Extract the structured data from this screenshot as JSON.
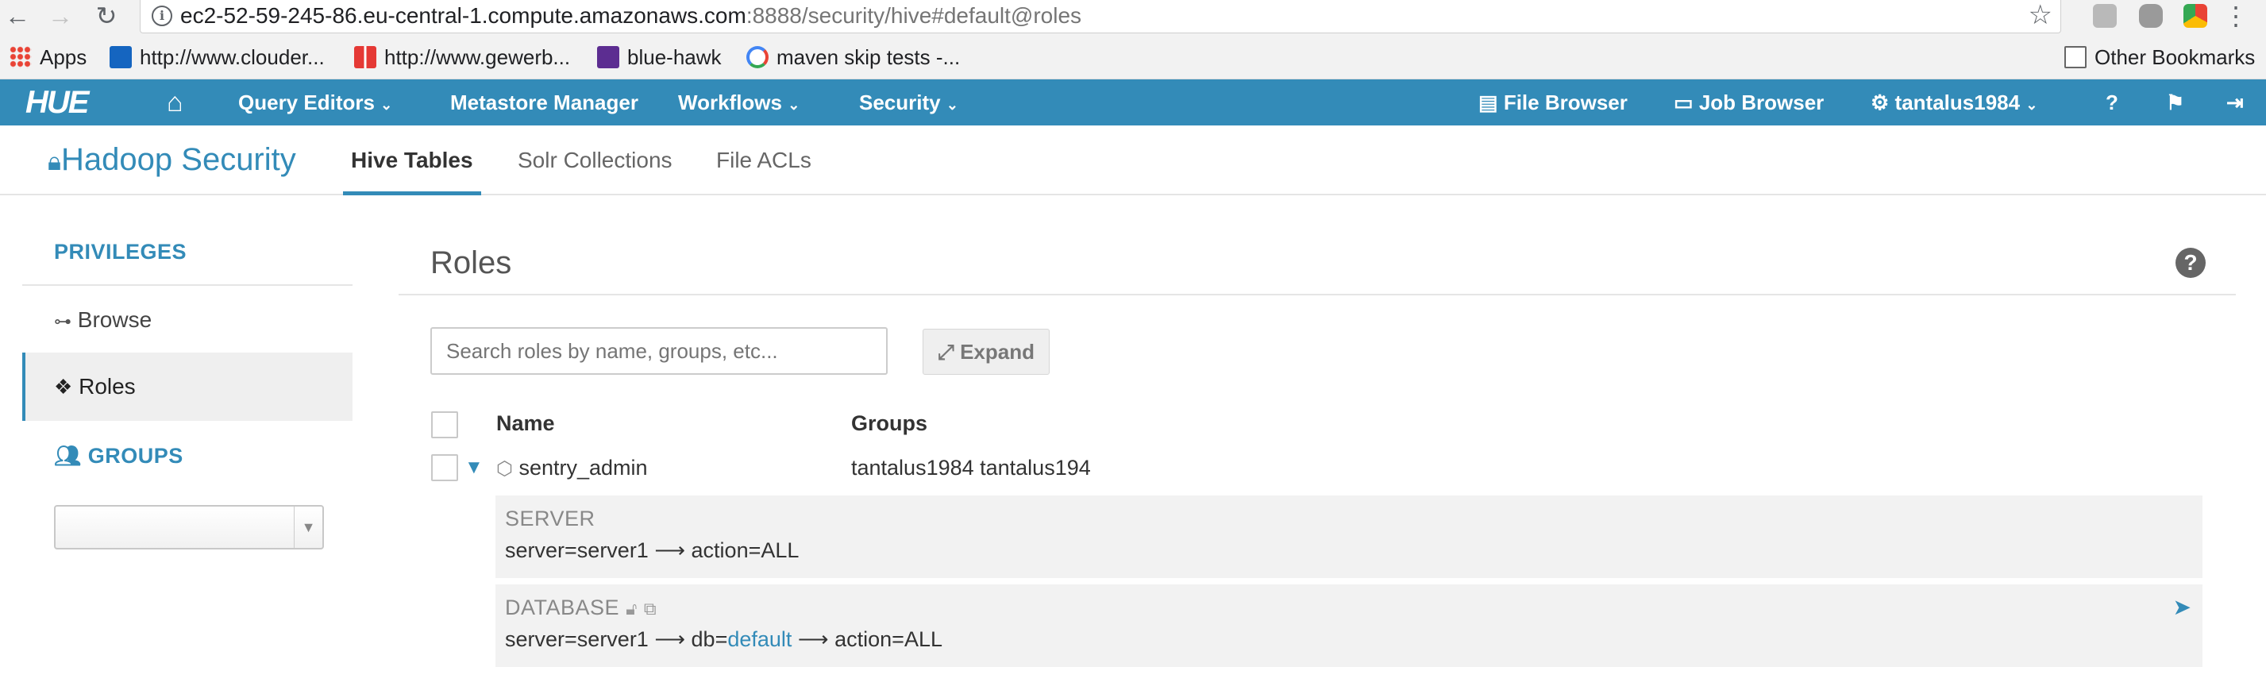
{
  "browser": {
    "url_host": "ec2-52-59-245-86.eu-central-1.compute.amazonaws.com",
    "url_rest": ":8888/security/hive#default@roles",
    "bookmarks": [
      {
        "label": "Apps",
        "color": "#e94335"
      },
      {
        "label": "http://www.clouder...",
        "color": "#1565c0"
      },
      {
        "label": "http://www.gewerb...",
        "color": "#e53935"
      },
      {
        "label": "blue-hawk",
        "color": "#5c2d91"
      },
      {
        "label": "maven skip tests -...",
        "color": "#4285f4"
      }
    ],
    "other_bookmarks": "Other Bookmarks"
  },
  "navbar": {
    "logo": "HUE",
    "home_icon": "home-icon",
    "query_editors": "Query Editors",
    "metastore": "Metastore Manager",
    "workflows": "Workflows",
    "security": "Security",
    "file_browser": "File Browser",
    "job_browser": "Job Browser",
    "user": "tantalus1984"
  },
  "header": {
    "title": "Hadoop Security",
    "tabs": [
      {
        "label": "Hive Tables",
        "active": true
      },
      {
        "label": "Solr Collections",
        "active": false
      },
      {
        "label": "File ACLs",
        "active": false
      }
    ]
  },
  "sidebar": {
    "privileges_label": "PRIVILEGES",
    "items": [
      {
        "label": "Browse",
        "active": false
      },
      {
        "label": "Roles",
        "active": true
      }
    ],
    "groups_label": "GROUPS",
    "group_selected": ""
  },
  "main": {
    "title": "Roles",
    "search_placeholder": "Search roles by name, groups, etc...",
    "expand_label": "Expand",
    "columns": {
      "name": "Name",
      "groups": "Groups"
    },
    "roles": [
      {
        "name": "sentry_admin",
        "groups": "tantalus1984 tantalus194",
        "privileges": [
          {
            "kind": "SERVER",
            "server": "server1",
            "db": null,
            "action": "ALL"
          },
          {
            "kind": "DATABASE",
            "server": "server1",
            "db": "default",
            "action": "ALL"
          }
        ]
      }
    ]
  },
  "colors": {
    "accent": "#338bb8",
    "nav_bg": "#338bb8",
    "panel_bg": "#f2f2f2"
  }
}
